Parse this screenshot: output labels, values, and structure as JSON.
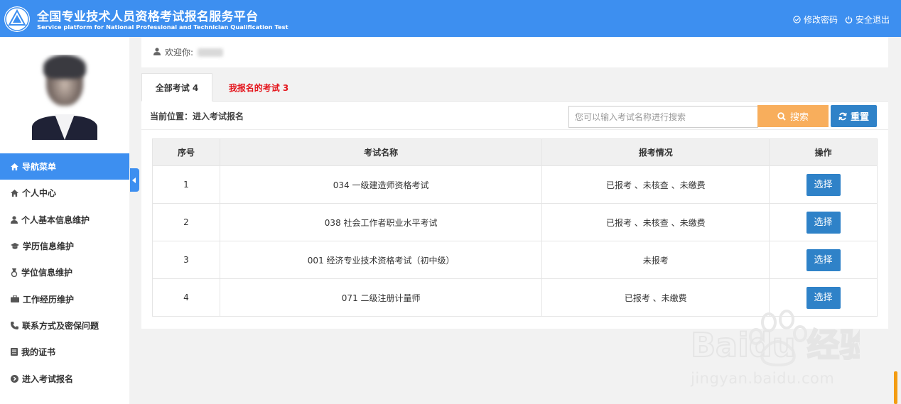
{
  "header": {
    "title_cn": "全国专业技术人员资格考试报名服务平台",
    "title_en": "Service platform for National Professional and Technician Qualification Test",
    "change_password": "修改密码",
    "logout": "安全退出",
    "brand_color": "#3d8ff0"
  },
  "sidebar": {
    "items": [
      {
        "label": "导航菜单",
        "icon": "home-icon"
      },
      {
        "label": "个人中心",
        "icon": "home-icon"
      },
      {
        "label": "个人基本信息维护",
        "icon": "user-icon"
      },
      {
        "label": "学历信息维护",
        "icon": "graduation-cap-icon"
      },
      {
        "label": "学位信息维护",
        "icon": "medal-icon"
      },
      {
        "label": "工作经历维护",
        "icon": "briefcase-icon"
      },
      {
        "label": "联系方式及密保问题",
        "icon": "phone-icon"
      },
      {
        "label": "我的证书",
        "icon": "book-icon"
      },
      {
        "label": "进入考试报名",
        "icon": "arrow-circle-icon"
      }
    ]
  },
  "welcome": {
    "label": "欢迎你:"
  },
  "tabs": [
    {
      "label": "全部考试 4"
    },
    {
      "label": "我报名的考试 3"
    }
  ],
  "toolbar": {
    "breadcrumb": "当前位置：进入考试报名",
    "search_placeholder": "您可以输入考试名称进行搜索",
    "search_label": "搜索",
    "reset_label": "重置"
  },
  "table": {
    "headers": [
      "序号",
      "考试名称",
      "报考情况",
      "操作"
    ],
    "rows": [
      {
        "no": "1",
        "name": "034 一级建造师资格考试",
        "status": "已报考 、未核查 、未缴费",
        "action": "选择"
      },
      {
        "no": "2",
        "name": "038 社会工作者职业水平考试",
        "status": "已报考 、未核查 、未缴费",
        "action": "选择"
      },
      {
        "no": "3",
        "name": "001 经济专业技术资格考试（初中级）",
        "status": "未报考",
        "action": "选择"
      },
      {
        "no": "4",
        "name": "071 二级注册计量师",
        "status": "已报考 、未缴费",
        "action": "选择"
      }
    ]
  },
  "watermark": {
    "brand": "Baidu 经验",
    "url": "jingyan.baidu.com"
  }
}
